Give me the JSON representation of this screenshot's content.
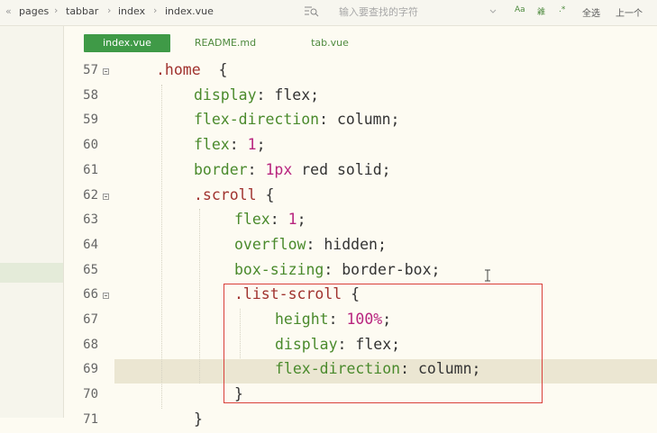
{
  "breadcrumb": {
    "back_glyph": "«",
    "items": [
      "pages",
      "tabbar",
      "index",
      "index.vue"
    ],
    "separator": "›"
  },
  "search": {
    "placeholder": "输入要查找的字符"
  },
  "find_tools": {
    "case_label": "Aa",
    "word_label": "䨀",
    "regex_label": ".*",
    "select_all_label": "全选",
    "prev_label": "上一个"
  },
  "tabs": [
    {
      "label": "index.vue",
      "active": true
    },
    {
      "label": "README.md",
      "active": false
    },
    {
      "label": "tab.vue",
      "active": false
    }
  ],
  "editor": {
    "highlighted_line": 69,
    "lines": [
      {
        "n": "57",
        "fold": true,
        "indent": 1,
        "tokens": [
          {
            "t": ".home",
            "c": "sel"
          },
          {
            "t": "  {",
            "c": ""
          }
        ]
      },
      {
        "n": "58",
        "fold": false,
        "indent": 2,
        "tokens": [
          {
            "t": "display",
            "c": "prop"
          },
          {
            "t": ": flex;",
            "c": ""
          }
        ]
      },
      {
        "n": "59",
        "fold": false,
        "indent": 2,
        "tokens": [
          {
            "t": "flex-direction",
            "c": "prop"
          },
          {
            "t": ": column;",
            "c": ""
          }
        ]
      },
      {
        "n": "60",
        "fold": false,
        "indent": 2,
        "tokens": [
          {
            "t": "flex",
            "c": "prop"
          },
          {
            "t": ": ",
            "c": ""
          },
          {
            "t": "1",
            "c": "num"
          },
          {
            "t": ";",
            "c": ""
          }
        ]
      },
      {
        "n": "61",
        "fold": false,
        "indent": 2,
        "tokens": [
          {
            "t": "border",
            "c": "prop"
          },
          {
            "t": ": ",
            "c": ""
          },
          {
            "t": "1px",
            "c": "num"
          },
          {
            "t": " red solid;",
            "c": ""
          }
        ]
      },
      {
        "n": "62",
        "fold": true,
        "indent": 2,
        "tokens": [
          {
            "t": ".scroll",
            "c": "sel"
          },
          {
            "t": " {",
            "c": ""
          }
        ]
      },
      {
        "n": "63",
        "fold": false,
        "indent": 3,
        "tokens": [
          {
            "t": "flex",
            "c": "prop"
          },
          {
            "t": ": ",
            "c": ""
          },
          {
            "t": "1",
            "c": "num"
          },
          {
            "t": ";",
            "c": ""
          }
        ]
      },
      {
        "n": "64",
        "fold": false,
        "indent": 3,
        "tokens": [
          {
            "t": "overflow",
            "c": "prop"
          },
          {
            "t": ": hidden;",
            "c": ""
          }
        ]
      },
      {
        "n": "65",
        "fold": false,
        "indent": 3,
        "tokens": [
          {
            "t": "box-sizing",
            "c": "prop"
          },
          {
            "t": ": border-box;",
            "c": ""
          }
        ]
      },
      {
        "n": "66",
        "fold": true,
        "indent": 3,
        "tokens": [
          {
            "t": ".list-scroll",
            "c": "sel"
          },
          {
            "t": " {",
            "c": ""
          }
        ]
      },
      {
        "n": "67",
        "fold": false,
        "indent": 4,
        "tokens": [
          {
            "t": "height",
            "c": "prop"
          },
          {
            "t": ": ",
            "c": ""
          },
          {
            "t": "100%",
            "c": "num"
          },
          {
            "t": ";",
            "c": ""
          }
        ]
      },
      {
        "n": "68",
        "fold": false,
        "indent": 4,
        "tokens": [
          {
            "t": "display",
            "c": "prop"
          },
          {
            "t": ": flex;",
            "c": ""
          }
        ]
      },
      {
        "n": "69",
        "fold": false,
        "indent": 4,
        "tokens": [
          {
            "t": "flex-direction",
            "c": "prop"
          },
          {
            "t": ": column;",
            "c": ""
          }
        ]
      },
      {
        "n": "70",
        "fold": false,
        "indent": 3,
        "tokens": [
          {
            "t": "}",
            "c": ""
          }
        ]
      },
      {
        "n": "71",
        "fold": false,
        "indent": 2,
        "tokens": [
          {
            "t": "}",
            "c": ""
          }
        ]
      }
    ]
  },
  "colors": {
    "selector": "#a0322e",
    "property": "#4a8a2c",
    "number": "#b8247e",
    "active_tab": "#3f9a47",
    "annotation": "#d9403a"
  }
}
